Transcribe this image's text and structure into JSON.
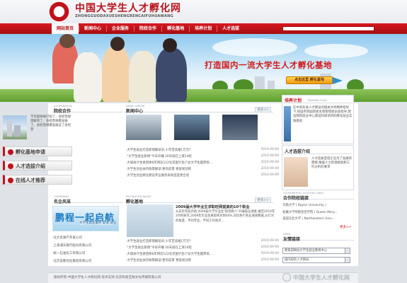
{
  "site": {
    "title": "中国大学生人才孵化网",
    "pinyin": "ZHONGGUODAXUESHENGRENCAIFUHUAWANG"
  },
  "nav": {
    "items": [
      "网站首页",
      "新闻中心",
      "企业服务",
      "院校合作",
      "孵化基地",
      "培养计划",
      "人才选拔"
    ],
    "active": "网站首页",
    "search_placeholder": ""
  },
  "banner": {
    "slogan": "打造国内一流大学生人才孵化基地",
    "button": "点击这里 孵化基地"
  },
  "cooperation": {
    "en": "COOPERATION",
    "title": "院校合作",
    "text": "不仅能够被打扮了，会经营规理解到了，会经营规模发展了，会经营规模发展这了会经营"
  },
  "buttons": {
    "incubate": "孵化基地申请",
    "select": "人才选拔介绍",
    "recruit": "在线人才推荐"
  },
  "news": {
    "en": "NEWS CENTER",
    "title": "新闻中心",
    "more": "更多>>",
    "items": [
      {
        "title": "·大学生就业打造新理解培训,十年苦读难1万元?",
        "date": "2010-09-09"
      },
      {
        "title": "·\"大学生就业新政\"今日开播 20天就在上演14招",
        "date": "2010-09-09"
      },
      {
        "title": "·大城县计生委团体6年将近122名贫困计生户女大学生圆梦高...",
        "date": "2010-09-09"
      },
      {
        "title": "·大学生创业扶持政策解读:更有前景 更容易创新",
        "date": "2010-09-09"
      },
      {
        "title": "·大学生创业孵化建设专业服务高效还是更合适",
        "date": "2010-09-09"
      }
    ]
  },
  "plan": {
    "en": "TRAINING PLAN",
    "title": "培养计划",
    "text": "在中央有关人才建设的相关文件精神指导下,经国务院国资委主管管理委员会指导,建设我院就业中心建设科研项目的孵化就业实践基地"
  },
  "talent": {
    "title": "人才选拔介绍",
    "text": "人才选拔是指企业为了发展的需要,根据人力资源规划和工作分析的要求"
  },
  "colleges": {
    "en": "COOPERATIVE COLLEGES LINKS",
    "title": "合作院校链接",
    "more": "更多>>",
    "items": [
      "·贝勒大学 ( Baylor University )",
      "·松嘉大学明那皇后学院 ( Queen Mary...",
      "·美国东北大学 ( Northeastern Univ..."
    ]
  },
  "links": {
    "en": "LINKS",
    "title": "友情链接",
    "select1": "教育部网站大学生就业教育中心",
    "select2": "国内知名人才网站"
  },
  "companies": {
    "en": "COMPANIES",
    "title": "名企风采",
    "ad_title": "鹏程一起启航",
    "ad_sub": "大学生就业服务 新道 就业",
    "items": [
      "·北大资源产开发公司",
      "·上海浦东银行股份有限公司",
      "·统一石油化工有限公司",
      "·北京首都创业集团有限公司"
    ]
  },
  "incubation": {
    "en": "INCUBATION BASES",
    "title": "孵化基地",
    "more": "更多>>",
    "article_title": "2009届大学毕业生求职旺网提高的10个职业",
    "article_body": "从去年年底开始,2009届大学毕业生\"职场新人\"开展就业调查,截至2010年2月的研究,2009年毕业生离职率达到40%,对比各行各业调查数据,从行为的角度、不同专业、不同工作地点...",
    "items": [
      {
        "title": "·大学生就业打造新理解培训,十年苦读难1万元?",
        "date": "2010-09-09"
      },
      {
        "title": "·\"大学生就业新政\"今日开播 20天就在上演14招",
        "date": "2010-09-09"
      },
      {
        "title": "·大城县计生委团体6年将近122名贫困计生户女大学生圆梦高...",
        "date": "2010-09-09"
      },
      {
        "title": "·大学生创业扶持政策解读:更有前景 更容易创新",
        "date": "2010-09-09"
      }
    ]
  },
  "footer": {
    "text": "版权所有:中国大学生人才孵化网   技术支持:北京和君互联文化传播有限公司",
    "logo_text": "中国大学生人才孵化网"
  },
  "colors": {
    "brand_red": "#c2121c",
    "nav_red": "#d71920",
    "accent_orange": "#f19a12"
  }
}
